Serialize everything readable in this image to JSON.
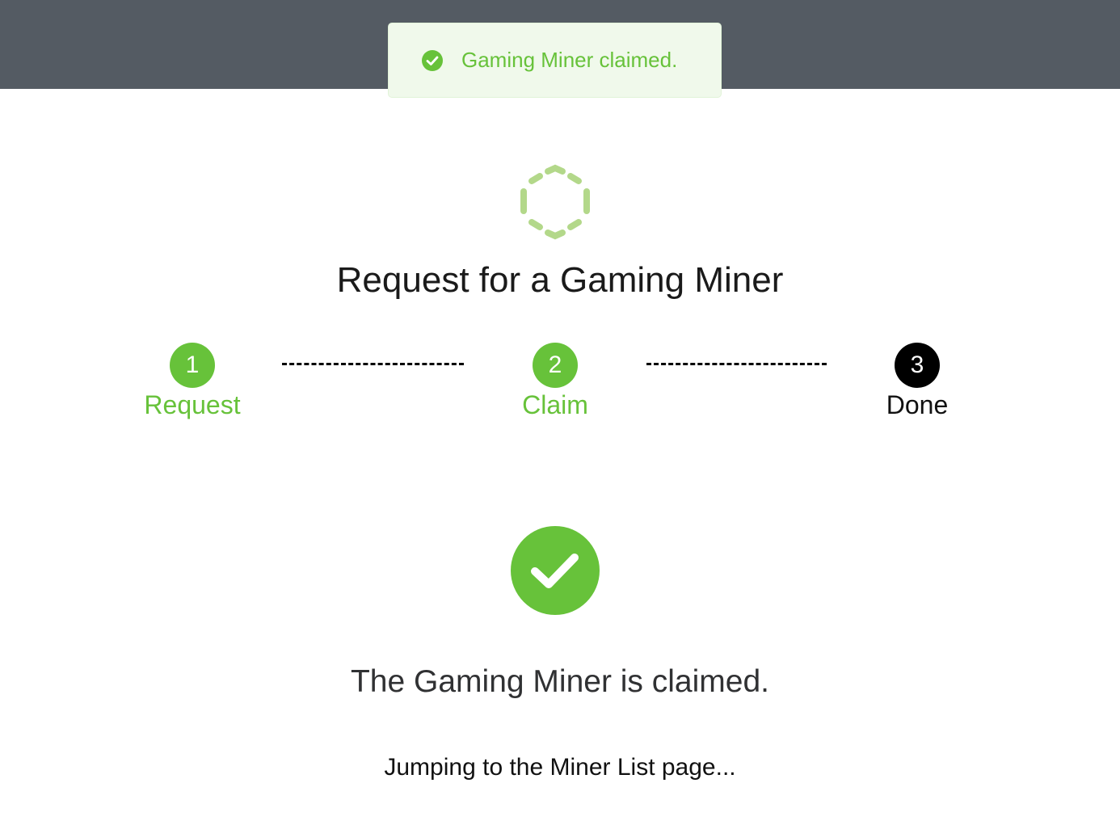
{
  "toast": {
    "icon": "success-check-icon",
    "message": "Gaming Miner claimed."
  },
  "header": {
    "logo_icon": "hexagon-spinner-icon",
    "title": "Request for a Gaming Miner"
  },
  "steps": [
    {
      "number": "1",
      "label": "Request",
      "status": "finished"
    },
    {
      "number": "2",
      "label": "Claim",
      "status": "finished"
    },
    {
      "number": "3",
      "label": "Done",
      "status": "current"
    }
  ],
  "result": {
    "icon": "success-check-icon",
    "message": "The Gaming Miner is claimed.",
    "redirect_text": "Jumping to the Miner List page..."
  },
  "colors": {
    "top_bar": "#545b63",
    "success": "#67c23a",
    "success_bg": "#f0f9eb",
    "logo": "#b3d88a",
    "current_step": "#000000"
  }
}
